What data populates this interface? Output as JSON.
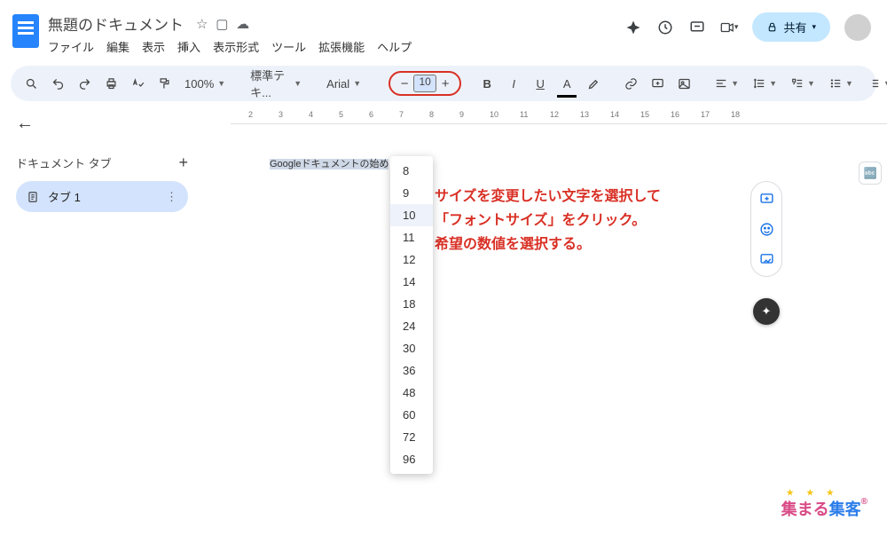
{
  "header": {
    "doc_title": "無題のドキュメント",
    "menus": [
      "ファイル",
      "編集",
      "表示",
      "挿入",
      "表示形式",
      "ツール",
      "拡張機能",
      "ヘルプ"
    ],
    "share_label": "共有"
  },
  "toolbar": {
    "zoom": "100%",
    "style_label": "標準テキ...",
    "font_label": "Arial",
    "font_size": "10"
  },
  "sidebar": {
    "section_title": "ドキュメント タブ",
    "tab_label": "タブ 1"
  },
  "document": {
    "selected_text": "Googleドキュメントの始め"
  },
  "font_size_options": [
    "8",
    "9",
    "10",
    "11",
    "12",
    "14",
    "18",
    "24",
    "30",
    "36",
    "48",
    "60",
    "72",
    "96"
  ],
  "font_size_selected": "10",
  "annotation": {
    "line1": "サイズを変更したい文字を選択して",
    "line2": "「フォントサイズ」をクリック。",
    "line3": "希望の数値を選択する。"
  },
  "ruler_marks": [
    2,
    3,
    4,
    5,
    6,
    7,
    8,
    9,
    10,
    11,
    12,
    13,
    14,
    15,
    16,
    17,
    18
  ],
  "watermark": {
    "part1": "集まる",
    "part2": "集客",
    "reg": "®"
  }
}
